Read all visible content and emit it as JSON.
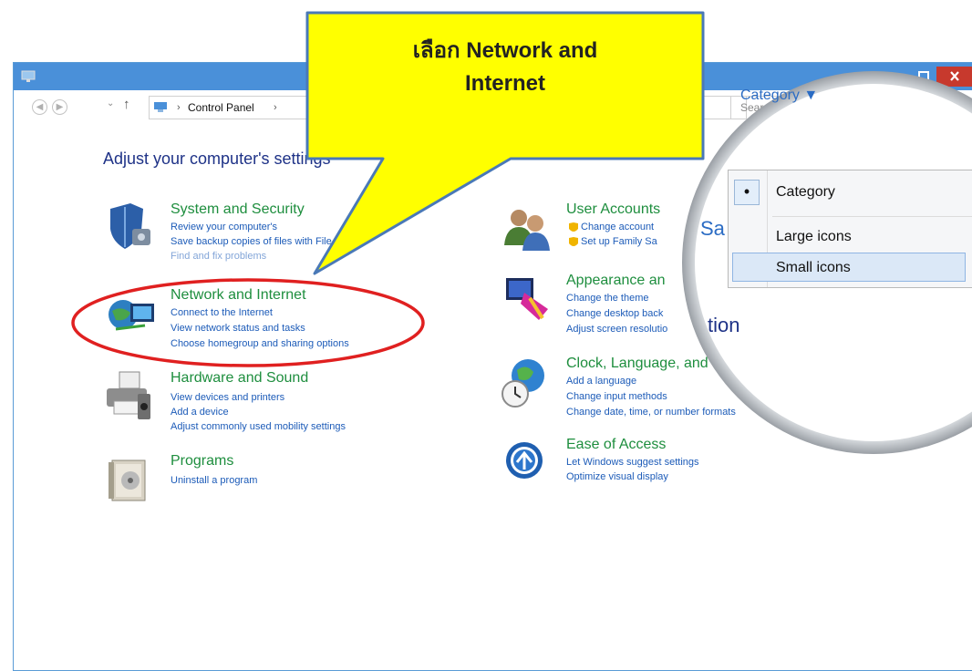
{
  "callout": {
    "line1": "เลือก Network and",
    "line2": "Internet"
  },
  "address": {
    "breadcrumb": "Control Panel",
    "search_placeholder": "Sear"
  },
  "heading": "Adjust your computer's settings",
  "view_by": {
    "selected": "Category ▼"
  },
  "view_menu": {
    "items": [
      "Category",
      "Large icons",
      "Small icons"
    ],
    "bullet": "•"
  },
  "magnified_fragments": [
    "Sa",
    "tion"
  ],
  "left_categories": [
    {
      "title": "System and Security",
      "links": [
        "Review your computer's",
        "Save backup copies of     files with File History",
        "Find and fix problems"
      ]
    },
    {
      "title": "Network and Internet",
      "links": [
        "Connect to the Internet",
        "View network status and tasks",
        "Choose homegroup and sharing options"
      ]
    },
    {
      "title": "Hardware and Sound",
      "links": [
        "View devices and printers",
        "Add a device",
        "Adjust commonly used mobility settings"
      ]
    },
    {
      "title": "Programs",
      "links": [
        "Uninstall a program"
      ]
    }
  ],
  "right_categories": [
    {
      "title": "User Accounts",
      "links": [
        "Change account",
        "Set up Family Sa"
      ]
    },
    {
      "title": "Appearance an",
      "links": [
        "Change the theme",
        "Change desktop back",
        "Adjust screen resolutio"
      ]
    },
    {
      "title": "Clock, Language, and",
      "links": [
        "Add a language",
        "Change input methods",
        "Change date, time, or number formats"
      ]
    },
    {
      "title": "Ease of Access",
      "links": [
        "Let Windows suggest settings",
        "Optimize visual display"
      ]
    }
  ],
  "colors": {
    "titlebar": "#4a90d9",
    "category_title": "#1e8e3e",
    "link": "#1c5bb8",
    "callout": "#ffff00",
    "highlight_ellipse": "#e02020"
  }
}
